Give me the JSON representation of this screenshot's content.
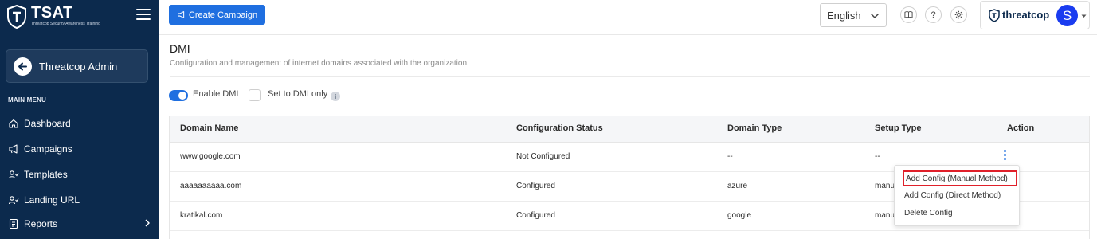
{
  "brand": {
    "title": "TSAT",
    "subtitle": "Threatcop Security Awareness Training"
  },
  "sidebar": {
    "admin_label": "Threatcop Admin",
    "menu_heading": "MAIN MENU",
    "items": [
      {
        "label": "Dashboard",
        "icon": "home-icon"
      },
      {
        "label": "Campaigns",
        "icon": "megaphone-icon"
      },
      {
        "label": "Templates",
        "icon": "users-icon"
      },
      {
        "label": "Landing URL",
        "icon": "users-icon"
      },
      {
        "label": "Reports",
        "icon": "report-icon"
      }
    ]
  },
  "topbar": {
    "create_label": "Create Campaign",
    "language": "English",
    "help_glyph": "?",
    "company": "threatcop",
    "avatar_letter": "S"
  },
  "page": {
    "title": "DMI",
    "description": "Configuration and management of internet domains associated with the organization.",
    "toggle_label": "Enable DMI",
    "toggle_on": true,
    "checkbox_label": "Set to DMI only",
    "checkbox_checked": false,
    "info_glyph": "i"
  },
  "table": {
    "headers": [
      "Domain Name",
      "Configuration Status",
      "Domain Type",
      "Setup Type",
      "Action"
    ],
    "rows": [
      {
        "domain": "www.google.com",
        "status": "Not Configured",
        "type": "--",
        "setup": "--"
      },
      {
        "domain": "aaaaaaaaaa.com",
        "status": "Configured",
        "type": "azure",
        "setup": "manu"
      },
      {
        "domain": "kratikal.com",
        "status": "Configured",
        "type": "google",
        "setup": "manu"
      }
    ]
  },
  "action_menu": {
    "items": [
      "Add Config (Manual Method)",
      "Add Config (Direct Method)",
      "Delete Config"
    ],
    "highlighted_index": 0
  },
  "colors": {
    "sidebar_bg": "#0c2a4d",
    "accent": "#1f6fe0",
    "highlight_border": "#e0202a",
    "avatar_bg": "#1a3cf0"
  }
}
